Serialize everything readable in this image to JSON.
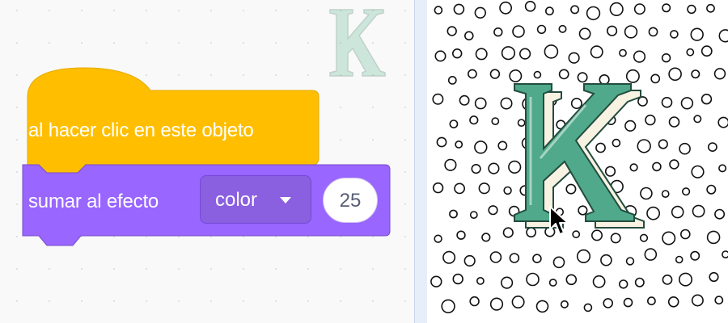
{
  "code_area": {
    "hat_block": {
      "label": "al hacer clic en este objeto",
      "color": "#ffbf00",
      "border": "#e6a800"
    },
    "effect_block": {
      "label": "sumar al efecto",
      "dropdown_value": "color",
      "number_value": "25",
      "color": "#9966ff",
      "border": "#774dcb"
    },
    "sprite_watermark": {
      "letter": "K",
      "color": "#5cb890"
    }
  },
  "stage": {
    "sprite": {
      "letter": "K",
      "fill": "#4fa98a",
      "cream": "#f7f2e2"
    },
    "backdrop": "polka-dots"
  }
}
